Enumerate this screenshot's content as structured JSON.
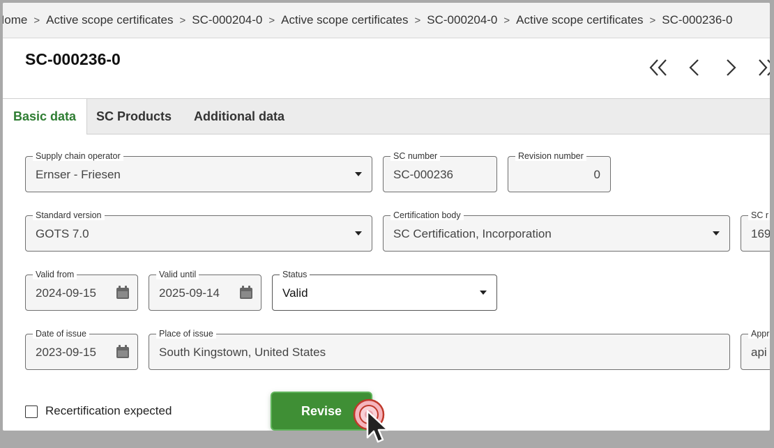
{
  "breadcrumb": {
    "items": [
      "Home",
      "Active scope certificates",
      "SC-000204-0",
      "Active scope certificates",
      "SC-000204-0",
      "Active scope certificates",
      "SC-000236-0"
    ],
    "separator": ">"
  },
  "header": {
    "title": "SC-000236-0",
    "nav_icons": [
      "double-chevron-left-icon",
      "chevron-left-icon",
      "chevron-right-icon",
      "double-chevron-right-icon"
    ]
  },
  "tabs": [
    {
      "label": "Basic data",
      "active": true
    },
    {
      "label": "SC Products",
      "active": false
    },
    {
      "label": "Additional data",
      "active": false
    }
  ],
  "form": {
    "supply_chain_operator": {
      "label": "Supply chain operator",
      "value": "Ernser - Friesen"
    },
    "sc_number": {
      "label": "SC number",
      "value": "SC-000236"
    },
    "revision_number": {
      "label": "Revision number",
      "value": "0"
    },
    "standard_version": {
      "label": "Standard version",
      "value": "GOTS 7.0"
    },
    "certification_body": {
      "label": "Certification body",
      "value": "SC Certification, Incorporation"
    },
    "sc_ref": {
      "label": "SC r",
      "value": "169"
    },
    "valid_from": {
      "label": "Valid from",
      "value": "2024-09-15"
    },
    "valid_until": {
      "label": "Valid until",
      "value": "2025-09-14"
    },
    "status": {
      "label": "Status",
      "value": "Valid"
    },
    "date_of_issue": {
      "label": "Date of issue",
      "value": "2023-09-15"
    },
    "place_of_issue": {
      "label": "Place of issue",
      "value": "South Kingstown, United States"
    },
    "approved_by": {
      "label": "Appr",
      "value": "api"
    }
  },
  "recertification": {
    "label": "Recertification expected",
    "checked": false
  },
  "actions": {
    "revise_label": "Revise"
  },
  "colors": {
    "accent": "#2e7d32",
    "button": "#3f8f35"
  }
}
